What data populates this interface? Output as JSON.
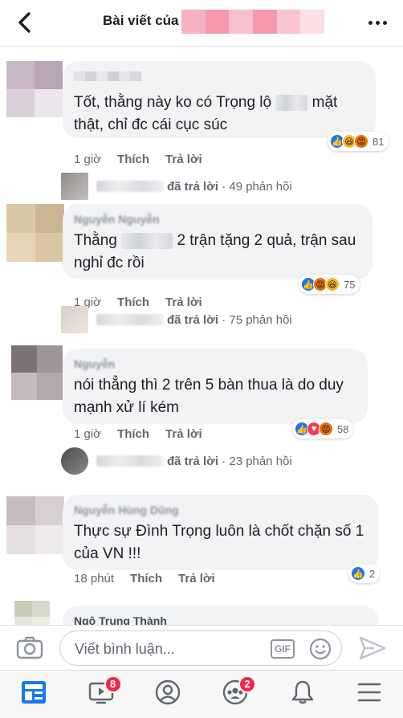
{
  "header": {
    "title": "Bài viết của",
    "back_icon": "back-arrow-icon",
    "more_icon": "more-dots-icon"
  },
  "comments": [
    {
      "text": "Tốt, thằng này ko có Trọng lộ",
      "text_end": "mặt thật, chỉ đc cái cục súc",
      "time": "1 giờ",
      "like": "Thích",
      "reply": "Trả lời",
      "reaction_icons": [
        "like",
        "haha",
        "angry"
      ],
      "reaction_count": "81",
      "reply_label": "đã trả lời",
      "reply_count": "· 49 phản hồi"
    },
    {
      "author": "Nguyễn Nguyễn",
      "text": "Thằng",
      "text_end": "2 trận tặng 2 quả, trận sau nghỉ đc rồi",
      "time": "1 giờ",
      "like": "Thích",
      "reply": "Trả lời",
      "reaction_icons": [
        "like",
        "angry",
        "haha"
      ],
      "reaction_count": "75",
      "reply_label": "đã trả lời",
      "reply_count": "· 75 phản hồi"
    },
    {
      "author": "Nguyễn",
      "text": "nói thẳng thì 2 trên 5 bàn thua là do duy mạnh xử lí kém",
      "time": "1 giờ",
      "like": "Thích",
      "reply": "Trả lời",
      "reaction_icons": [
        "like",
        "love",
        "angry"
      ],
      "reaction_count": "58",
      "reply_label": "đã trả lời",
      "reply_count": "· 23 phản hồi"
    },
    {
      "author": "Nguyễn Hùng Dũng",
      "text": "Thực sự Đình Trọng luôn là chốt chặn số 1 của VN !!!",
      "time": "18 phút",
      "like": "Thích",
      "reply": "Trả lời",
      "reaction_icons": [
        "like"
      ],
      "reaction_count": "2"
    },
    {
      "author": "Ngô Trung Thành"
    }
  ],
  "composer": {
    "placeholder": "Viết bình luận...",
    "gif_label": "GIF"
  },
  "nav": {
    "tabs": [
      {
        "icon": "news-feed-icon",
        "badge": ""
      },
      {
        "icon": "watch-video-icon",
        "badge": "8"
      },
      {
        "icon": "profile-icon",
        "badge": ""
      },
      {
        "icon": "groups-icon",
        "badge": "2"
      },
      {
        "icon": "notifications-bell-icon",
        "badge": ""
      },
      {
        "icon": "menu-icon",
        "badge": ""
      }
    ]
  },
  "colors": {
    "brand_blue": "#1877f2",
    "bubble_bg": "#f2f3f5",
    "badge_red": "#f02849",
    "meta_grey": "#606770"
  }
}
